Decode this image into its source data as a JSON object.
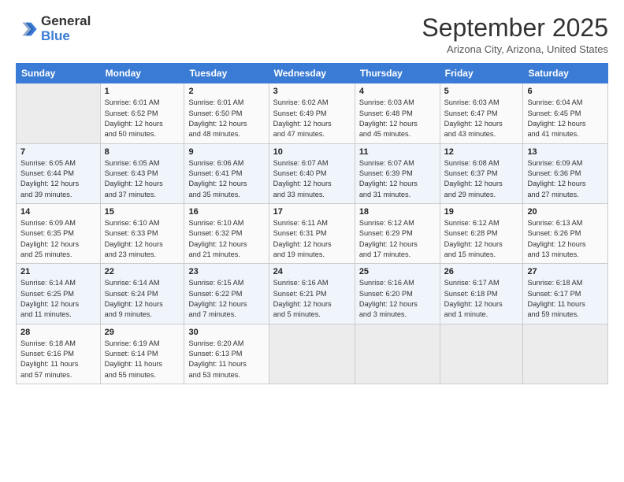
{
  "header": {
    "logo_line1": "General",
    "logo_line2": "Blue",
    "month_title": "September 2025",
    "location": "Arizona City, Arizona, United States"
  },
  "days_of_week": [
    "Sunday",
    "Monday",
    "Tuesday",
    "Wednesday",
    "Thursday",
    "Friday",
    "Saturday"
  ],
  "weeks": [
    [
      {
        "day": "",
        "info": ""
      },
      {
        "day": "1",
        "info": "Sunrise: 6:01 AM\nSunset: 6:52 PM\nDaylight: 12 hours\nand 50 minutes."
      },
      {
        "day": "2",
        "info": "Sunrise: 6:01 AM\nSunset: 6:50 PM\nDaylight: 12 hours\nand 48 minutes."
      },
      {
        "day": "3",
        "info": "Sunrise: 6:02 AM\nSunset: 6:49 PM\nDaylight: 12 hours\nand 47 minutes."
      },
      {
        "day": "4",
        "info": "Sunrise: 6:03 AM\nSunset: 6:48 PM\nDaylight: 12 hours\nand 45 minutes."
      },
      {
        "day": "5",
        "info": "Sunrise: 6:03 AM\nSunset: 6:47 PM\nDaylight: 12 hours\nand 43 minutes."
      },
      {
        "day": "6",
        "info": "Sunrise: 6:04 AM\nSunset: 6:45 PM\nDaylight: 12 hours\nand 41 minutes."
      }
    ],
    [
      {
        "day": "7",
        "info": "Sunrise: 6:05 AM\nSunset: 6:44 PM\nDaylight: 12 hours\nand 39 minutes."
      },
      {
        "day": "8",
        "info": "Sunrise: 6:05 AM\nSunset: 6:43 PM\nDaylight: 12 hours\nand 37 minutes."
      },
      {
        "day": "9",
        "info": "Sunrise: 6:06 AM\nSunset: 6:41 PM\nDaylight: 12 hours\nand 35 minutes."
      },
      {
        "day": "10",
        "info": "Sunrise: 6:07 AM\nSunset: 6:40 PM\nDaylight: 12 hours\nand 33 minutes."
      },
      {
        "day": "11",
        "info": "Sunrise: 6:07 AM\nSunset: 6:39 PM\nDaylight: 12 hours\nand 31 minutes."
      },
      {
        "day": "12",
        "info": "Sunrise: 6:08 AM\nSunset: 6:37 PM\nDaylight: 12 hours\nand 29 minutes."
      },
      {
        "day": "13",
        "info": "Sunrise: 6:09 AM\nSunset: 6:36 PM\nDaylight: 12 hours\nand 27 minutes."
      }
    ],
    [
      {
        "day": "14",
        "info": "Sunrise: 6:09 AM\nSunset: 6:35 PM\nDaylight: 12 hours\nand 25 minutes."
      },
      {
        "day": "15",
        "info": "Sunrise: 6:10 AM\nSunset: 6:33 PM\nDaylight: 12 hours\nand 23 minutes."
      },
      {
        "day": "16",
        "info": "Sunrise: 6:10 AM\nSunset: 6:32 PM\nDaylight: 12 hours\nand 21 minutes."
      },
      {
        "day": "17",
        "info": "Sunrise: 6:11 AM\nSunset: 6:31 PM\nDaylight: 12 hours\nand 19 minutes."
      },
      {
        "day": "18",
        "info": "Sunrise: 6:12 AM\nSunset: 6:29 PM\nDaylight: 12 hours\nand 17 minutes."
      },
      {
        "day": "19",
        "info": "Sunrise: 6:12 AM\nSunset: 6:28 PM\nDaylight: 12 hours\nand 15 minutes."
      },
      {
        "day": "20",
        "info": "Sunrise: 6:13 AM\nSunset: 6:26 PM\nDaylight: 12 hours\nand 13 minutes."
      }
    ],
    [
      {
        "day": "21",
        "info": "Sunrise: 6:14 AM\nSunset: 6:25 PM\nDaylight: 12 hours\nand 11 minutes."
      },
      {
        "day": "22",
        "info": "Sunrise: 6:14 AM\nSunset: 6:24 PM\nDaylight: 12 hours\nand 9 minutes."
      },
      {
        "day": "23",
        "info": "Sunrise: 6:15 AM\nSunset: 6:22 PM\nDaylight: 12 hours\nand 7 minutes."
      },
      {
        "day": "24",
        "info": "Sunrise: 6:16 AM\nSunset: 6:21 PM\nDaylight: 12 hours\nand 5 minutes."
      },
      {
        "day": "25",
        "info": "Sunrise: 6:16 AM\nSunset: 6:20 PM\nDaylight: 12 hours\nand 3 minutes."
      },
      {
        "day": "26",
        "info": "Sunrise: 6:17 AM\nSunset: 6:18 PM\nDaylight: 12 hours\nand 1 minute."
      },
      {
        "day": "27",
        "info": "Sunrise: 6:18 AM\nSunset: 6:17 PM\nDaylight: 11 hours\nand 59 minutes."
      }
    ],
    [
      {
        "day": "28",
        "info": "Sunrise: 6:18 AM\nSunset: 6:16 PM\nDaylight: 11 hours\nand 57 minutes."
      },
      {
        "day": "29",
        "info": "Sunrise: 6:19 AM\nSunset: 6:14 PM\nDaylight: 11 hours\nand 55 minutes."
      },
      {
        "day": "30",
        "info": "Sunrise: 6:20 AM\nSunset: 6:13 PM\nDaylight: 11 hours\nand 53 minutes."
      },
      {
        "day": "",
        "info": ""
      },
      {
        "day": "",
        "info": ""
      },
      {
        "day": "",
        "info": ""
      },
      {
        "day": "",
        "info": ""
      }
    ]
  ]
}
